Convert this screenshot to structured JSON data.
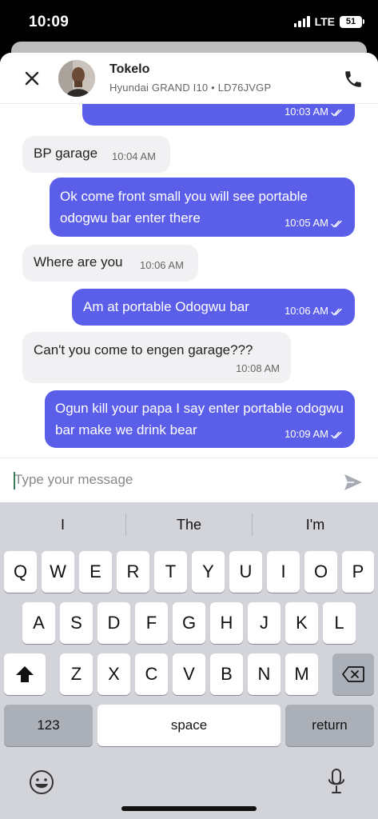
{
  "status_bar": {
    "time": "10:09",
    "network": "LTE",
    "battery": "51"
  },
  "header": {
    "name": "Tokelo",
    "vehicle": "Hyundai GRAND I10 • LD76JVGP",
    "avatar_alt": "Driver photo"
  },
  "messages": [
    {
      "side": "out",
      "text": "",
      "time": "10:03 AM",
      "read": true
    },
    {
      "side": "in",
      "text": "BP garage",
      "time": "10:04 AM"
    },
    {
      "side": "out",
      "text": "Ok come front small you will see portable odogwu bar enter there",
      "time": "10:05 AM",
      "read": true
    },
    {
      "side": "in",
      "text": "Where are you",
      "time": "10:06 AM"
    },
    {
      "side": "out",
      "text": "Am at portable Odogwu bar",
      "time": "10:06 AM",
      "read": true
    },
    {
      "side": "in",
      "text": "Can't you come to engen garage???",
      "time": "10:08 AM"
    },
    {
      "side": "out",
      "text": "Ogun kill your papa I say enter portable odogwu bar make we drink bear",
      "time": "10:09 AM",
      "read": true
    }
  ],
  "composer": {
    "placeholder": "Type your message",
    "value": ""
  },
  "keyboard": {
    "suggestions": [
      "I",
      "The",
      "I'm"
    ],
    "row1": [
      "Q",
      "W",
      "E",
      "R",
      "T",
      "Y",
      "U",
      "I",
      "O",
      "P"
    ],
    "row2": [
      "A",
      "S",
      "D",
      "F",
      "G",
      "H",
      "J",
      "K",
      "L"
    ],
    "row3": [
      "Z",
      "X",
      "C",
      "V",
      "B",
      "N",
      "M"
    ],
    "numbers_label": "123",
    "space_label": "space",
    "return_label": "return"
  }
}
